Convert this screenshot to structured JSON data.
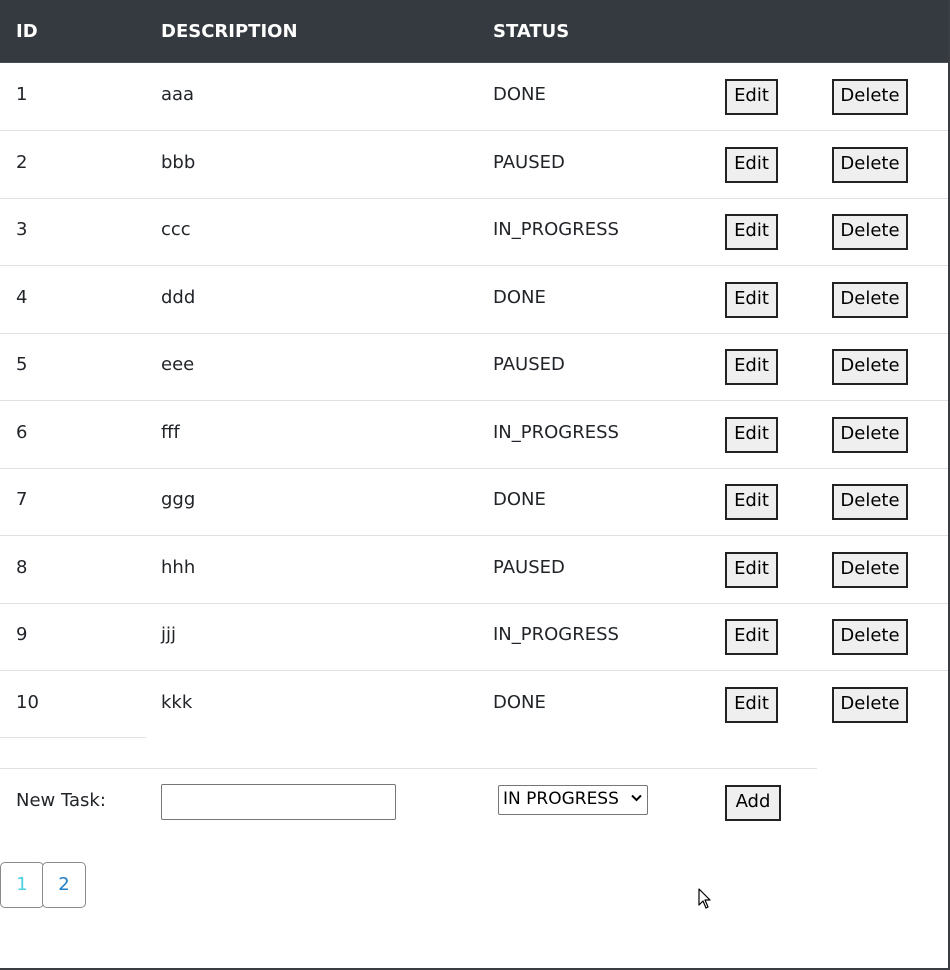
{
  "table": {
    "headers": {
      "id": "ID",
      "description": "DESCRIPTION",
      "status": "STATUS"
    },
    "rows": [
      {
        "id": "1",
        "description": "aaa",
        "status": "DONE"
      },
      {
        "id": "2",
        "description": "bbb",
        "status": "PAUSED"
      },
      {
        "id": "3",
        "description": "ccc",
        "status": "IN_PROGRESS"
      },
      {
        "id": "4",
        "description": "ddd",
        "status": "DONE"
      },
      {
        "id": "5",
        "description": "eee",
        "status": "PAUSED"
      },
      {
        "id": "6",
        "description": "fff",
        "status": "IN_PROGRESS"
      },
      {
        "id": "7",
        "description": "ggg",
        "status": "DONE"
      },
      {
        "id": "8",
        "description": "hhh",
        "status": "PAUSED"
      },
      {
        "id": "9",
        "description": "jjj",
        "status": "IN_PROGRESS"
      },
      {
        "id": "10",
        "description": "kkk",
        "status": "DONE"
      }
    ],
    "edit_label": "Edit",
    "delete_label": "Delete"
  },
  "new_task": {
    "label": "New Task:",
    "input_value": "",
    "input_placeholder": "",
    "status_selected": "IN PROGRESS",
    "add_label": "Add"
  },
  "pagination": {
    "pages": [
      "1",
      "2"
    ],
    "current": "1"
  },
  "colors": {
    "header_bg": "#343a40",
    "header_text": "#ffffff",
    "current_page": "#4fd0e0",
    "page_link": "#1e7ec8"
  },
  "icons": {
    "select_chevron": "chevron-down-icon",
    "mouse": "mouse-pointer-icon"
  }
}
